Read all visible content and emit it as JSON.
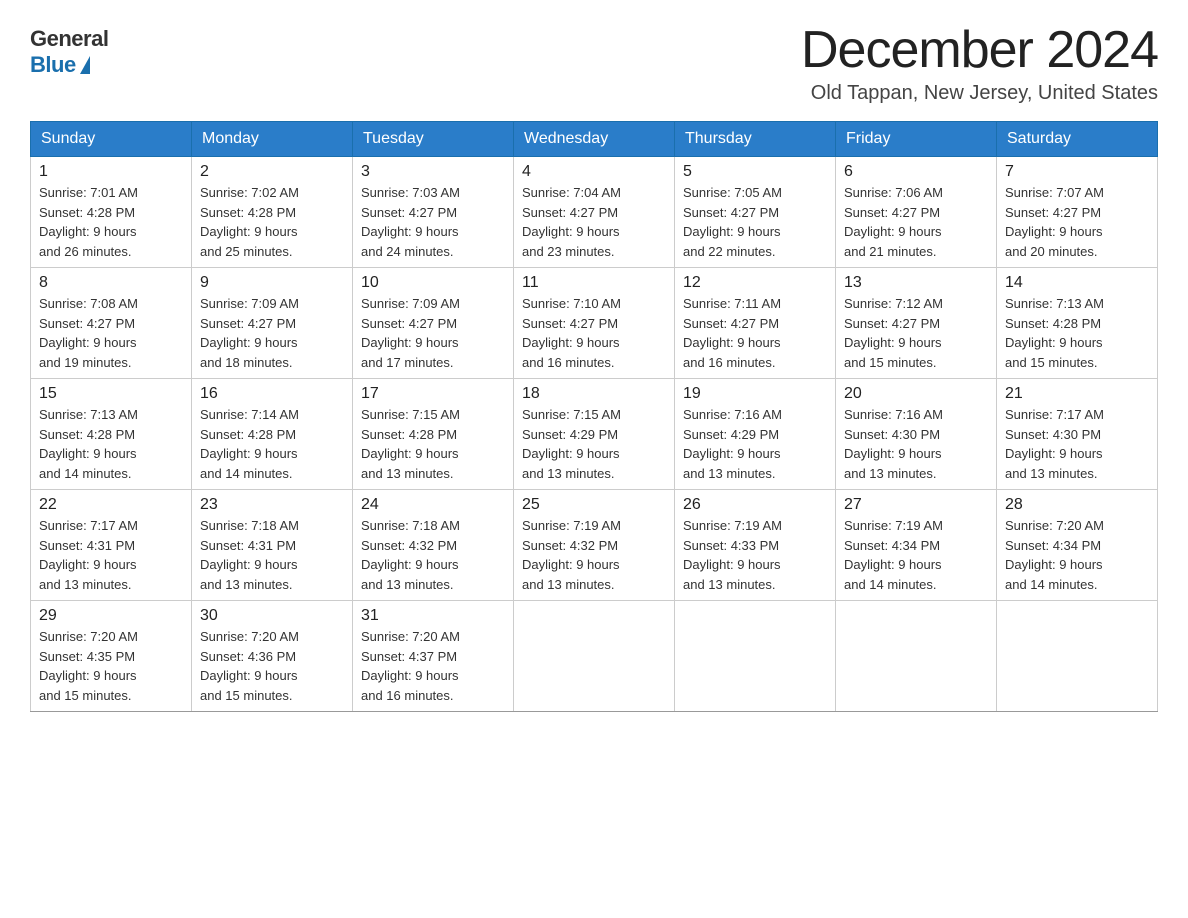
{
  "logo": {
    "general": "General",
    "blue": "Blue"
  },
  "header": {
    "month": "December 2024",
    "location": "Old Tappan, New Jersey, United States"
  },
  "weekdays": [
    "Sunday",
    "Monday",
    "Tuesday",
    "Wednesday",
    "Thursday",
    "Friday",
    "Saturday"
  ],
  "weeks": [
    [
      {
        "day": "1",
        "sunrise": "7:01 AM",
        "sunset": "4:28 PM",
        "daylight": "9 hours and 26 minutes."
      },
      {
        "day": "2",
        "sunrise": "7:02 AM",
        "sunset": "4:28 PM",
        "daylight": "9 hours and 25 minutes."
      },
      {
        "day": "3",
        "sunrise": "7:03 AM",
        "sunset": "4:27 PM",
        "daylight": "9 hours and 24 minutes."
      },
      {
        "day": "4",
        "sunrise": "7:04 AM",
        "sunset": "4:27 PM",
        "daylight": "9 hours and 23 minutes."
      },
      {
        "day": "5",
        "sunrise": "7:05 AM",
        "sunset": "4:27 PM",
        "daylight": "9 hours and 22 minutes."
      },
      {
        "day": "6",
        "sunrise": "7:06 AM",
        "sunset": "4:27 PM",
        "daylight": "9 hours and 21 minutes."
      },
      {
        "day": "7",
        "sunrise": "7:07 AM",
        "sunset": "4:27 PM",
        "daylight": "9 hours and 20 minutes."
      }
    ],
    [
      {
        "day": "8",
        "sunrise": "7:08 AM",
        "sunset": "4:27 PM",
        "daylight": "9 hours and 19 minutes."
      },
      {
        "day": "9",
        "sunrise": "7:09 AM",
        "sunset": "4:27 PM",
        "daylight": "9 hours and 18 minutes."
      },
      {
        "day": "10",
        "sunrise": "7:09 AM",
        "sunset": "4:27 PM",
        "daylight": "9 hours and 17 minutes."
      },
      {
        "day": "11",
        "sunrise": "7:10 AM",
        "sunset": "4:27 PM",
        "daylight": "9 hours and 16 minutes."
      },
      {
        "day": "12",
        "sunrise": "7:11 AM",
        "sunset": "4:27 PM",
        "daylight": "9 hours and 16 minutes."
      },
      {
        "day": "13",
        "sunrise": "7:12 AM",
        "sunset": "4:27 PM",
        "daylight": "9 hours and 15 minutes."
      },
      {
        "day": "14",
        "sunrise": "7:13 AM",
        "sunset": "4:28 PM",
        "daylight": "9 hours and 15 minutes."
      }
    ],
    [
      {
        "day": "15",
        "sunrise": "7:13 AM",
        "sunset": "4:28 PM",
        "daylight": "9 hours and 14 minutes."
      },
      {
        "day": "16",
        "sunrise": "7:14 AM",
        "sunset": "4:28 PM",
        "daylight": "9 hours and 14 minutes."
      },
      {
        "day": "17",
        "sunrise": "7:15 AM",
        "sunset": "4:28 PM",
        "daylight": "9 hours and 13 minutes."
      },
      {
        "day": "18",
        "sunrise": "7:15 AM",
        "sunset": "4:29 PM",
        "daylight": "9 hours and 13 minutes."
      },
      {
        "day": "19",
        "sunrise": "7:16 AM",
        "sunset": "4:29 PM",
        "daylight": "9 hours and 13 minutes."
      },
      {
        "day": "20",
        "sunrise": "7:16 AM",
        "sunset": "4:30 PM",
        "daylight": "9 hours and 13 minutes."
      },
      {
        "day": "21",
        "sunrise": "7:17 AM",
        "sunset": "4:30 PM",
        "daylight": "9 hours and 13 minutes."
      }
    ],
    [
      {
        "day": "22",
        "sunrise": "7:17 AM",
        "sunset": "4:31 PM",
        "daylight": "9 hours and 13 minutes."
      },
      {
        "day": "23",
        "sunrise": "7:18 AM",
        "sunset": "4:31 PM",
        "daylight": "9 hours and 13 minutes."
      },
      {
        "day": "24",
        "sunrise": "7:18 AM",
        "sunset": "4:32 PM",
        "daylight": "9 hours and 13 minutes."
      },
      {
        "day": "25",
        "sunrise": "7:19 AM",
        "sunset": "4:32 PM",
        "daylight": "9 hours and 13 minutes."
      },
      {
        "day": "26",
        "sunrise": "7:19 AM",
        "sunset": "4:33 PM",
        "daylight": "9 hours and 13 minutes."
      },
      {
        "day": "27",
        "sunrise": "7:19 AM",
        "sunset": "4:34 PM",
        "daylight": "9 hours and 14 minutes."
      },
      {
        "day": "28",
        "sunrise": "7:20 AM",
        "sunset": "4:34 PM",
        "daylight": "9 hours and 14 minutes."
      }
    ],
    [
      {
        "day": "29",
        "sunrise": "7:20 AM",
        "sunset": "4:35 PM",
        "daylight": "9 hours and 15 minutes."
      },
      {
        "day": "30",
        "sunrise": "7:20 AM",
        "sunset": "4:36 PM",
        "daylight": "9 hours and 15 minutes."
      },
      {
        "day": "31",
        "sunrise": "7:20 AM",
        "sunset": "4:37 PM",
        "daylight": "9 hours and 16 minutes."
      },
      null,
      null,
      null,
      null
    ]
  ],
  "labels": {
    "sunrise": "Sunrise:",
    "sunset": "Sunset:",
    "daylight": "Daylight:"
  }
}
